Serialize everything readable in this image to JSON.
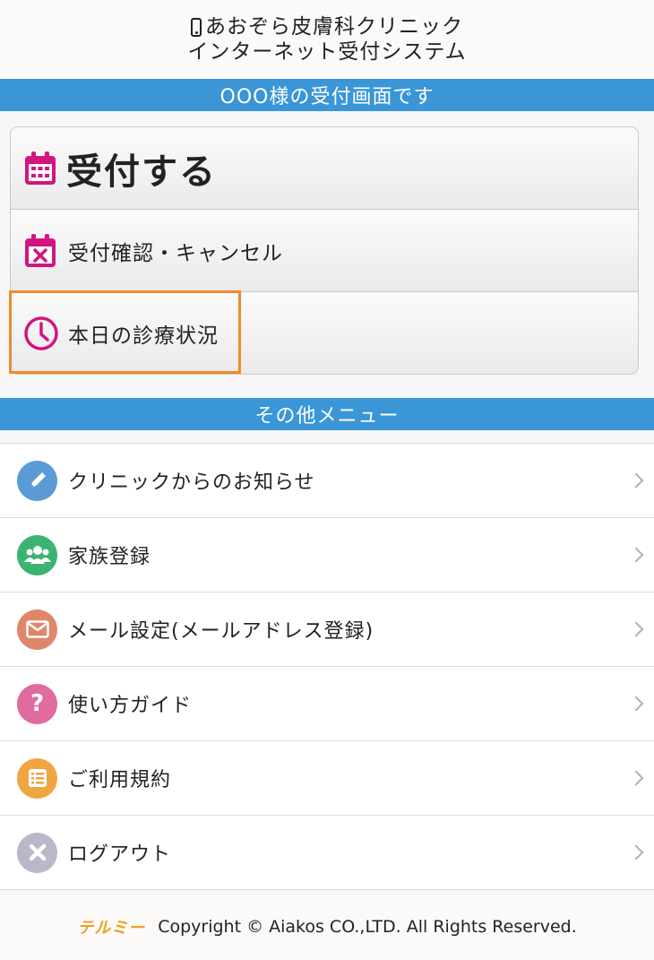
{
  "header": {
    "line1": "あおぞら皮膚科クリニック",
    "line2": "インターネット受付システム"
  },
  "user_banner": "OOO様の受付画面です",
  "main_actions": [
    {
      "label": "受付する",
      "icon": "calendar-icon"
    },
    {
      "label": "受付確認・キャンセル",
      "icon": "calendar-cancel-icon"
    },
    {
      "label": "本日の診療状況",
      "icon": "clock-icon"
    }
  ],
  "other_menu_banner": "その他メニュー",
  "menu": [
    {
      "label": "クリニックからのお知らせ",
      "icon": "pencil-icon",
      "color": "#5b9bd5"
    },
    {
      "label": "家族登録",
      "icon": "people-icon",
      "color": "#3cb371"
    },
    {
      "label": "メール設定(メールアドレス登録)",
      "icon": "mail-icon",
      "color": "#e0876a"
    },
    {
      "label": "使い方ガイド",
      "icon": "question-icon",
      "color": "#e06b9e"
    },
    {
      "label": "ご利用規約",
      "icon": "list-icon",
      "color": "#f0a640"
    },
    {
      "label": "ログアウト",
      "icon": "close-icon",
      "color": "#b8b8c8"
    }
  ],
  "footer": {
    "logo": "テルミー",
    "copyright": "Copyright © Aiakos CO.,LTD. All Rights Reserved."
  },
  "colors": {
    "banner": "#3a96d6",
    "accent_magenta": "#d4147f",
    "highlight": "#f08a2e"
  }
}
